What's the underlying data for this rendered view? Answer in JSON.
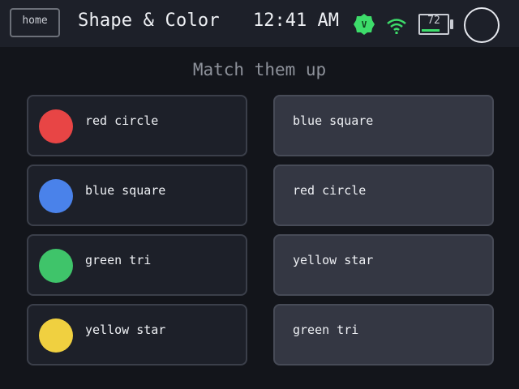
{
  "header": {
    "home_label": "home",
    "title": "Shape & Color",
    "time": "12:41 AM",
    "badge_letter": "V",
    "battery_level": "72",
    "battery_fraction": 0.72,
    "icons": [
      "home-button",
      "verified-badge-icon",
      "wifi-icon",
      "battery-icon",
      "profile-circle-icon"
    ]
  },
  "prompt": "Match them up",
  "left_items": [
    {
      "label": "red circle",
      "color": "#e84545"
    },
    {
      "label": "blue square",
      "color": "#4a82ea"
    },
    {
      "label": "green tri",
      "color": "#3fc46a"
    },
    {
      "label": "yellow star",
      "color": "#f0d040"
    }
  ],
  "right_items": [
    {
      "label": "blue square"
    },
    {
      "label": "red circle"
    },
    {
      "label": "yellow star"
    },
    {
      "label": "green tri"
    }
  ],
  "colors": {
    "accent_green": "#3ddc6a",
    "background": "#13151b",
    "topbar": "#1d2029"
  }
}
